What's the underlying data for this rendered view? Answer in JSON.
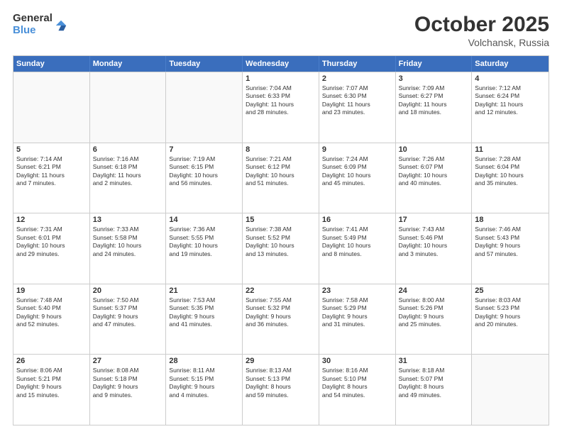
{
  "header": {
    "logo_general": "General",
    "logo_blue": "Blue",
    "month": "October 2025",
    "location": "Volchansk, Russia"
  },
  "weekdays": [
    "Sunday",
    "Monday",
    "Tuesday",
    "Wednesday",
    "Thursday",
    "Friday",
    "Saturday"
  ],
  "rows": [
    [
      {
        "day": "",
        "info": ""
      },
      {
        "day": "",
        "info": ""
      },
      {
        "day": "",
        "info": ""
      },
      {
        "day": "1",
        "info": "Sunrise: 7:04 AM\nSunset: 6:33 PM\nDaylight: 11 hours\nand 28 minutes."
      },
      {
        "day": "2",
        "info": "Sunrise: 7:07 AM\nSunset: 6:30 PM\nDaylight: 11 hours\nand 23 minutes."
      },
      {
        "day": "3",
        "info": "Sunrise: 7:09 AM\nSunset: 6:27 PM\nDaylight: 11 hours\nand 18 minutes."
      },
      {
        "day": "4",
        "info": "Sunrise: 7:12 AM\nSunset: 6:24 PM\nDaylight: 11 hours\nand 12 minutes."
      }
    ],
    [
      {
        "day": "5",
        "info": "Sunrise: 7:14 AM\nSunset: 6:21 PM\nDaylight: 11 hours\nand 7 minutes."
      },
      {
        "day": "6",
        "info": "Sunrise: 7:16 AM\nSunset: 6:18 PM\nDaylight: 11 hours\nand 2 minutes."
      },
      {
        "day": "7",
        "info": "Sunrise: 7:19 AM\nSunset: 6:15 PM\nDaylight: 10 hours\nand 56 minutes."
      },
      {
        "day": "8",
        "info": "Sunrise: 7:21 AM\nSunset: 6:12 PM\nDaylight: 10 hours\nand 51 minutes."
      },
      {
        "day": "9",
        "info": "Sunrise: 7:24 AM\nSunset: 6:09 PM\nDaylight: 10 hours\nand 45 minutes."
      },
      {
        "day": "10",
        "info": "Sunrise: 7:26 AM\nSunset: 6:07 PM\nDaylight: 10 hours\nand 40 minutes."
      },
      {
        "day": "11",
        "info": "Sunrise: 7:28 AM\nSunset: 6:04 PM\nDaylight: 10 hours\nand 35 minutes."
      }
    ],
    [
      {
        "day": "12",
        "info": "Sunrise: 7:31 AM\nSunset: 6:01 PM\nDaylight: 10 hours\nand 29 minutes."
      },
      {
        "day": "13",
        "info": "Sunrise: 7:33 AM\nSunset: 5:58 PM\nDaylight: 10 hours\nand 24 minutes."
      },
      {
        "day": "14",
        "info": "Sunrise: 7:36 AM\nSunset: 5:55 PM\nDaylight: 10 hours\nand 19 minutes."
      },
      {
        "day": "15",
        "info": "Sunrise: 7:38 AM\nSunset: 5:52 PM\nDaylight: 10 hours\nand 13 minutes."
      },
      {
        "day": "16",
        "info": "Sunrise: 7:41 AM\nSunset: 5:49 PM\nDaylight: 10 hours\nand 8 minutes."
      },
      {
        "day": "17",
        "info": "Sunrise: 7:43 AM\nSunset: 5:46 PM\nDaylight: 10 hours\nand 3 minutes."
      },
      {
        "day": "18",
        "info": "Sunrise: 7:46 AM\nSunset: 5:43 PM\nDaylight: 9 hours\nand 57 minutes."
      }
    ],
    [
      {
        "day": "19",
        "info": "Sunrise: 7:48 AM\nSunset: 5:40 PM\nDaylight: 9 hours\nand 52 minutes."
      },
      {
        "day": "20",
        "info": "Sunrise: 7:50 AM\nSunset: 5:37 PM\nDaylight: 9 hours\nand 47 minutes."
      },
      {
        "day": "21",
        "info": "Sunrise: 7:53 AM\nSunset: 5:35 PM\nDaylight: 9 hours\nand 41 minutes."
      },
      {
        "day": "22",
        "info": "Sunrise: 7:55 AM\nSunset: 5:32 PM\nDaylight: 9 hours\nand 36 minutes."
      },
      {
        "day": "23",
        "info": "Sunrise: 7:58 AM\nSunset: 5:29 PM\nDaylight: 9 hours\nand 31 minutes."
      },
      {
        "day": "24",
        "info": "Sunrise: 8:00 AM\nSunset: 5:26 PM\nDaylight: 9 hours\nand 25 minutes."
      },
      {
        "day": "25",
        "info": "Sunrise: 8:03 AM\nSunset: 5:23 PM\nDaylight: 9 hours\nand 20 minutes."
      }
    ],
    [
      {
        "day": "26",
        "info": "Sunrise: 8:06 AM\nSunset: 5:21 PM\nDaylight: 9 hours\nand 15 minutes."
      },
      {
        "day": "27",
        "info": "Sunrise: 8:08 AM\nSunset: 5:18 PM\nDaylight: 9 hours\nand 9 minutes."
      },
      {
        "day": "28",
        "info": "Sunrise: 8:11 AM\nSunset: 5:15 PM\nDaylight: 9 hours\nand 4 minutes."
      },
      {
        "day": "29",
        "info": "Sunrise: 8:13 AM\nSunset: 5:13 PM\nDaylight: 8 hours\nand 59 minutes."
      },
      {
        "day": "30",
        "info": "Sunrise: 8:16 AM\nSunset: 5:10 PM\nDaylight: 8 hours\nand 54 minutes."
      },
      {
        "day": "31",
        "info": "Sunrise: 8:18 AM\nSunset: 5:07 PM\nDaylight: 8 hours\nand 49 minutes."
      },
      {
        "day": "",
        "info": ""
      }
    ]
  ]
}
